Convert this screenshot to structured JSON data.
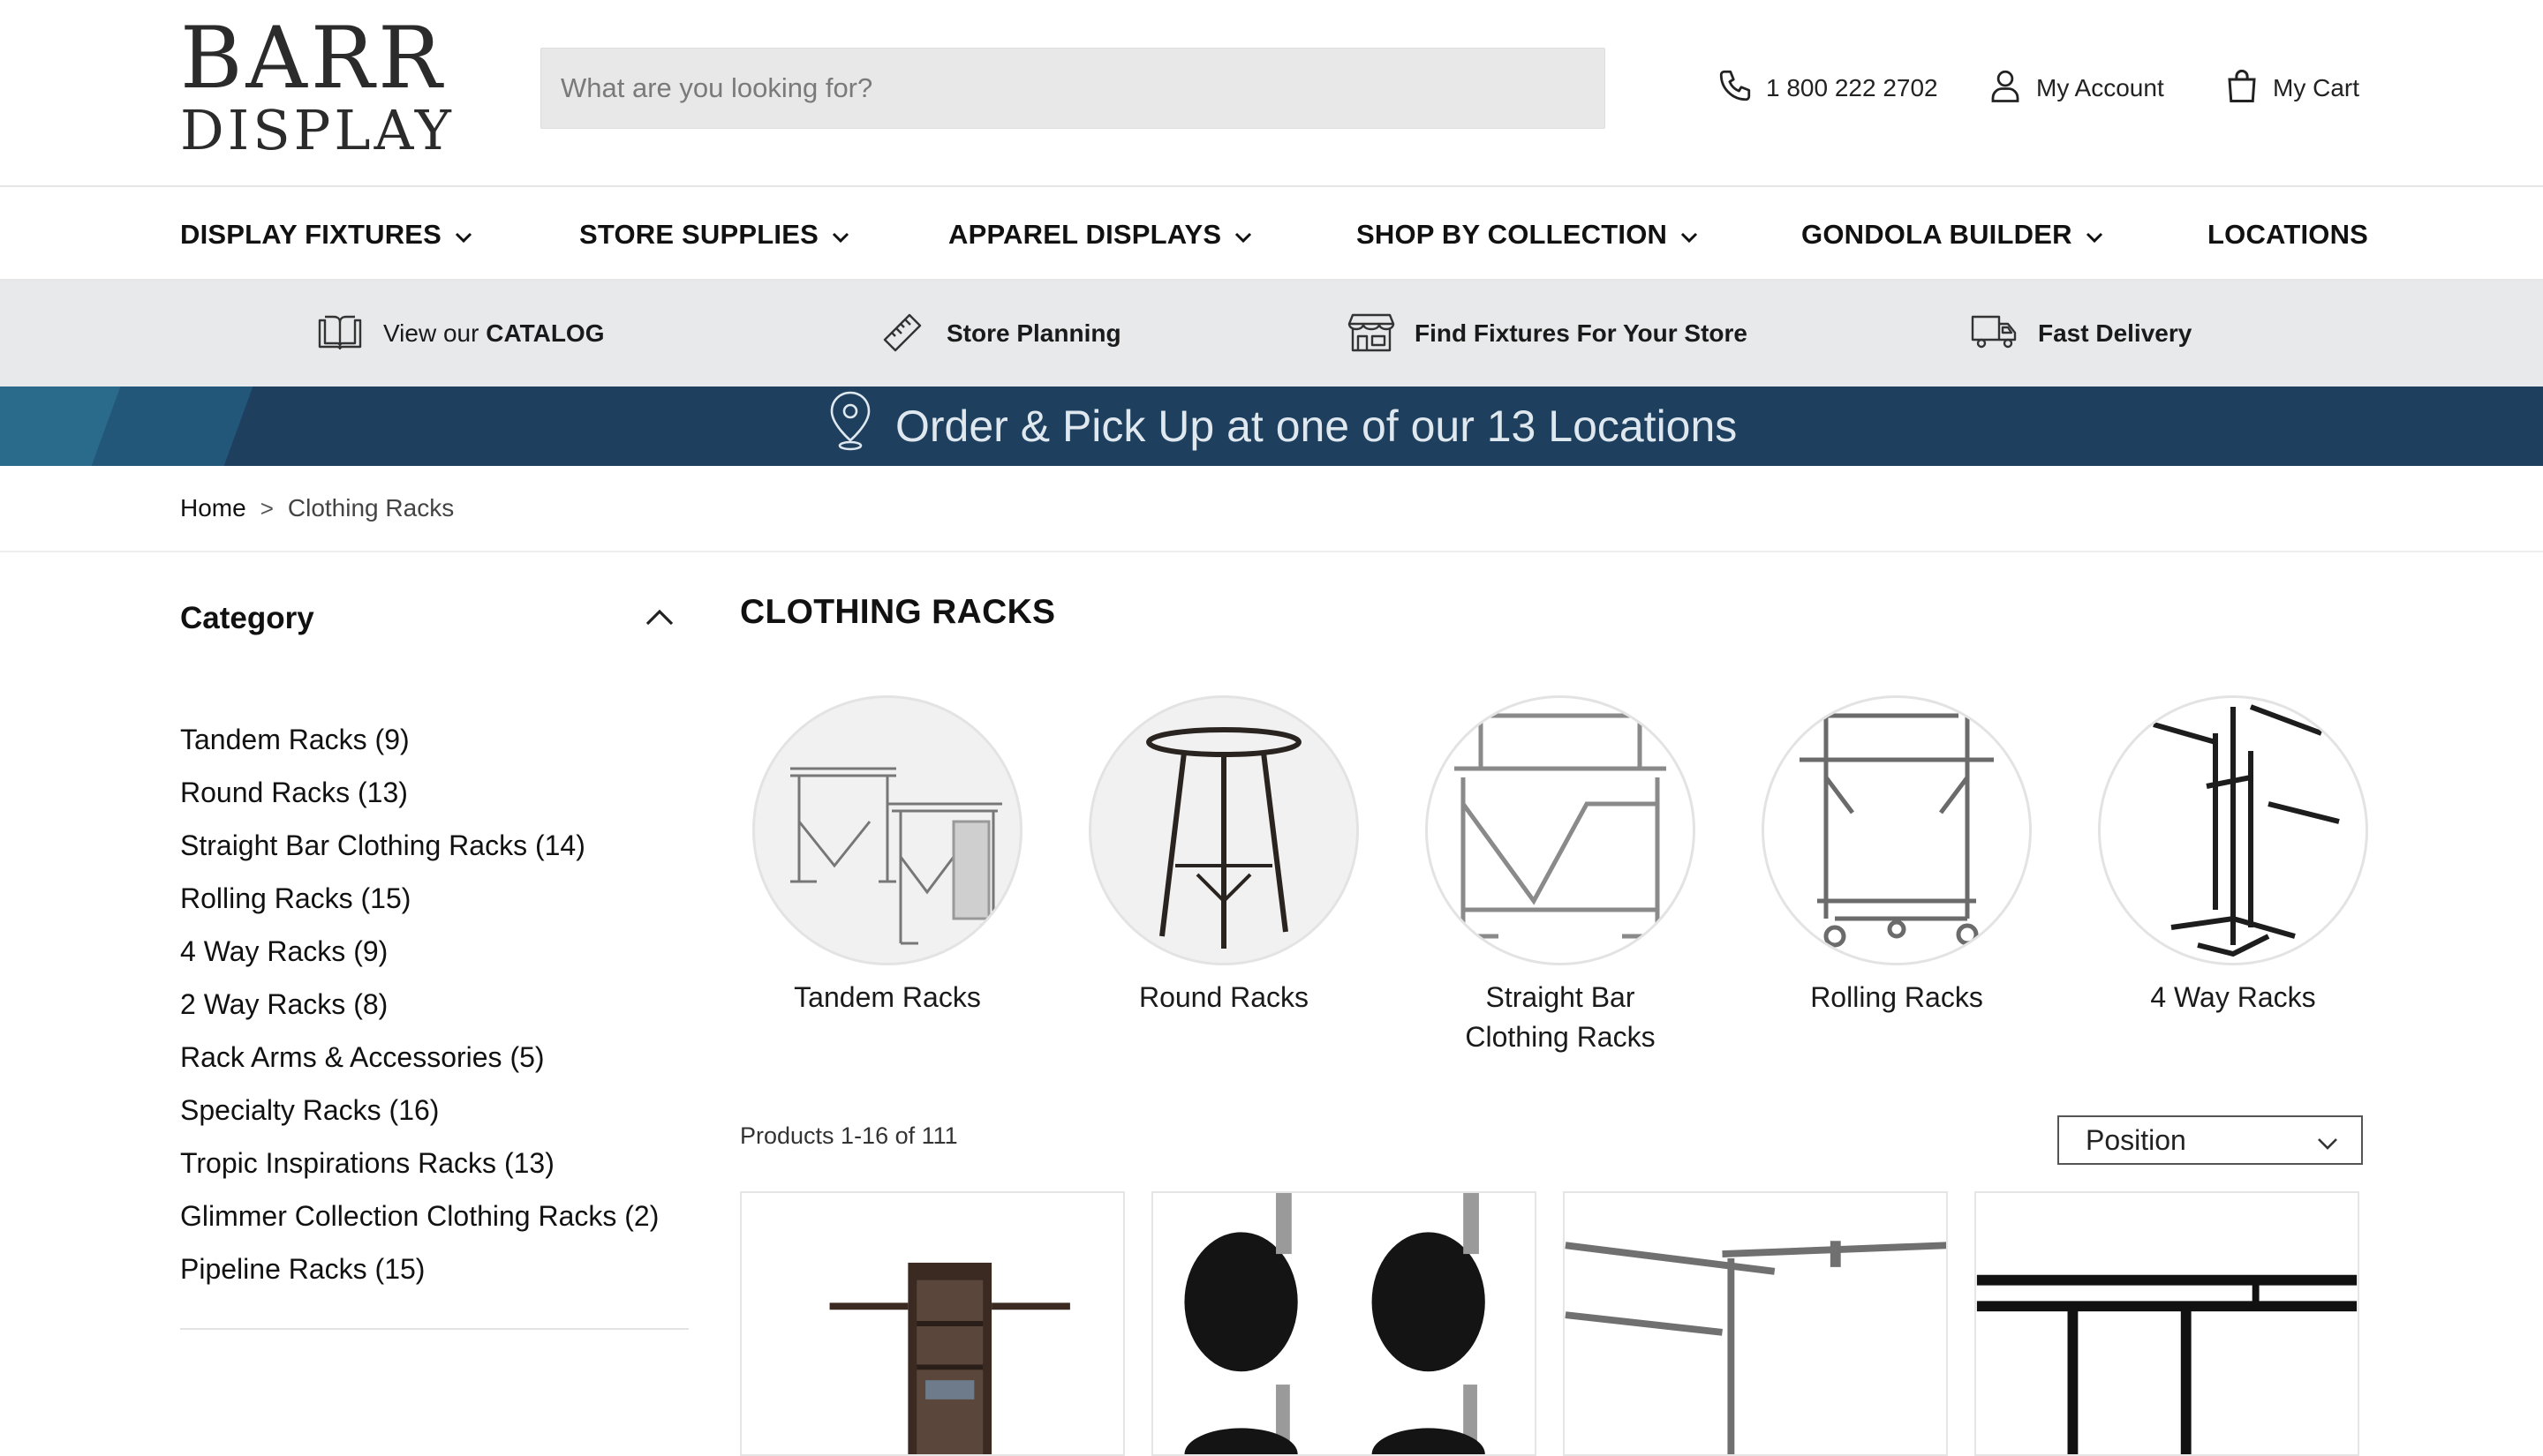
{
  "header": {
    "logo": {
      "line1": "BARR",
      "line2": "DISPLAY"
    },
    "search_placeholder": "What are you looking for?",
    "phone": "1 800 222 2702",
    "account_label": "My Account",
    "cart_label": "My Cart"
  },
  "nav": {
    "items": [
      {
        "label": "DISPLAY FIXTURES",
        "has_dropdown": true
      },
      {
        "label": "STORE SUPPLIES",
        "has_dropdown": true
      },
      {
        "label": "APPAREL DISPLAYS",
        "has_dropdown": true
      },
      {
        "label": "SHOP BY COLLECTION",
        "has_dropdown": true
      },
      {
        "label": "GONDOLA BUILDER",
        "has_dropdown": true
      },
      {
        "label": "LOCATIONS",
        "has_dropdown": false
      }
    ]
  },
  "features": {
    "catalog_prefix": "View our",
    "catalog_strong": "CATALOG",
    "planning": "Store Planning",
    "find": "Find Fixtures For Your Store",
    "delivery": "Fast Delivery"
  },
  "promo": {
    "text": "Order & Pick Up at one of our 13 Locations"
  },
  "breadcrumb": {
    "home": "Home",
    "separator": ">",
    "current": "Clothing Racks"
  },
  "sidebar": {
    "heading": "Category",
    "categories": [
      "Tandem Racks (9)",
      "Round Racks (13)",
      "Straight Bar Clothing Racks (14)",
      "Rolling Racks (15)",
      "4 Way Racks (9)",
      "2 Way Racks (8)",
      "Rack Arms & Accessories (5)",
      "Specialty Racks (16)",
      "Tropic Inspirations Racks (13)",
      "Glimmer Collection Clothing Racks (2)",
      "Pipeline Racks (15)"
    ]
  },
  "main": {
    "title": "CLOTHING RACKS",
    "subcategories": [
      {
        "line1": "Tandem Racks",
        "line2": ""
      },
      {
        "line1": "Round Racks",
        "line2": ""
      },
      {
        "line1": "Straight Bar",
        "line2": "Clothing Racks"
      },
      {
        "line1": "Rolling Racks",
        "line2": ""
      },
      {
        "line1": "4 Way Racks",
        "line2": ""
      }
    ],
    "product_count": "Products 1-16 of 111",
    "sort_selected": "Position"
  },
  "colors": {
    "promo_bg": "#1e3f5e",
    "feature_bar_bg": "#e8e9ea",
    "search_bg": "#e8e8e8"
  },
  "icons": {
    "phone": "phone-icon",
    "account": "user-icon",
    "cart": "bag-icon",
    "catalog": "book-icon",
    "planning": "ruler-icon",
    "find": "storefront-icon",
    "delivery": "truck-icon",
    "promo": "map-pin-icon"
  }
}
